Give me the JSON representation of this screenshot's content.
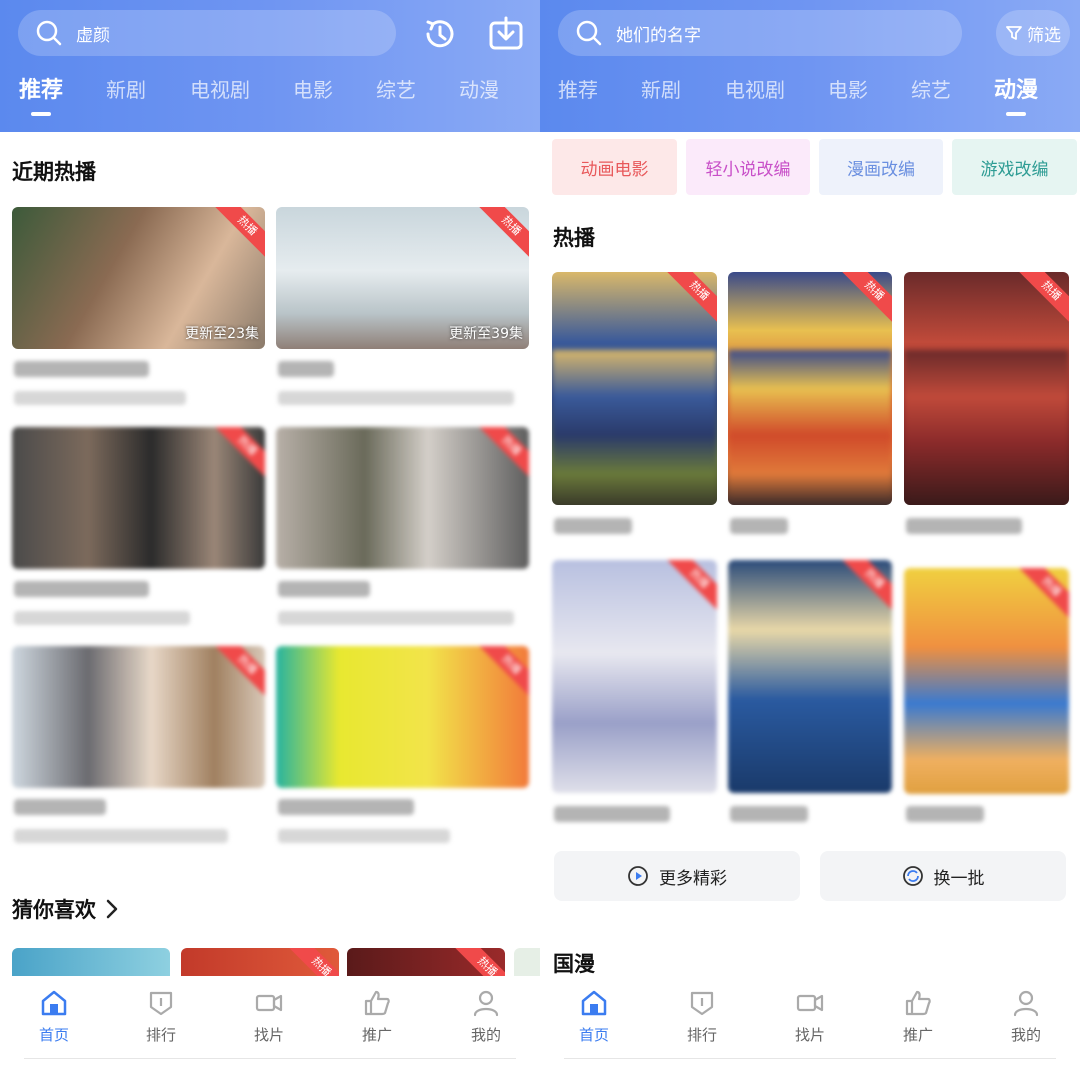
{
  "left": {
    "search": {
      "placeholder": "虚颜"
    },
    "tabs": [
      {
        "label": "推荐",
        "active": true
      },
      {
        "label": "新剧",
        "active": false
      },
      {
        "label": "电视剧",
        "active": false
      },
      {
        "label": "电影",
        "active": false
      },
      {
        "label": "综艺",
        "active": false
      },
      {
        "label": "动漫",
        "active": false
      }
    ],
    "section_hot": "近期热播",
    "section_guess": "猜你喜欢",
    "badge": "热播",
    "cards": [
      {
        "episodes": "更新至23集"
      },
      {
        "episodes": "更新至39集"
      }
    ]
  },
  "right": {
    "search": {
      "placeholder": "她们的名字"
    },
    "filter_label": "筛选",
    "tabs": [
      {
        "label": "推荐",
        "active": false
      },
      {
        "label": "新剧",
        "active": false
      },
      {
        "label": "电视剧",
        "active": false
      },
      {
        "label": "电影",
        "active": false
      },
      {
        "label": "综艺",
        "active": false
      },
      {
        "label": "动漫",
        "active": true
      }
    ],
    "genres": [
      {
        "label": "动画电影",
        "color": "#e8585a",
        "bg": "#fde8e8"
      },
      {
        "label": "轻小说改编",
        "color": "#c84fc8",
        "bg": "#fbeafa"
      },
      {
        "label": "漫画改编",
        "color": "#6a8fe0",
        "bg": "#eef2fb"
      },
      {
        "label": "游戏改编",
        "color": "#2e9c94",
        "bg": "#e6f5f2"
      }
    ],
    "section_hot": "热播",
    "section_guoman": "国漫",
    "badge": "热播",
    "more_label": "更多精彩",
    "refresh_label": "换一批"
  },
  "bottom_nav": [
    {
      "label": "首页",
      "icon": "home-icon",
      "active": true
    },
    {
      "label": "排行",
      "icon": "ranking-icon",
      "active": false
    },
    {
      "label": "找片",
      "icon": "camera-icon",
      "active": false
    },
    {
      "label": "推广",
      "icon": "thumbs-up-icon",
      "active": false
    },
    {
      "label": "我的",
      "icon": "profile-icon",
      "active": false
    }
  ],
  "colors": {
    "header_blue": "#5b89ee",
    "accent": "#3b7cf0",
    "badge_red": "#f04a4a"
  }
}
